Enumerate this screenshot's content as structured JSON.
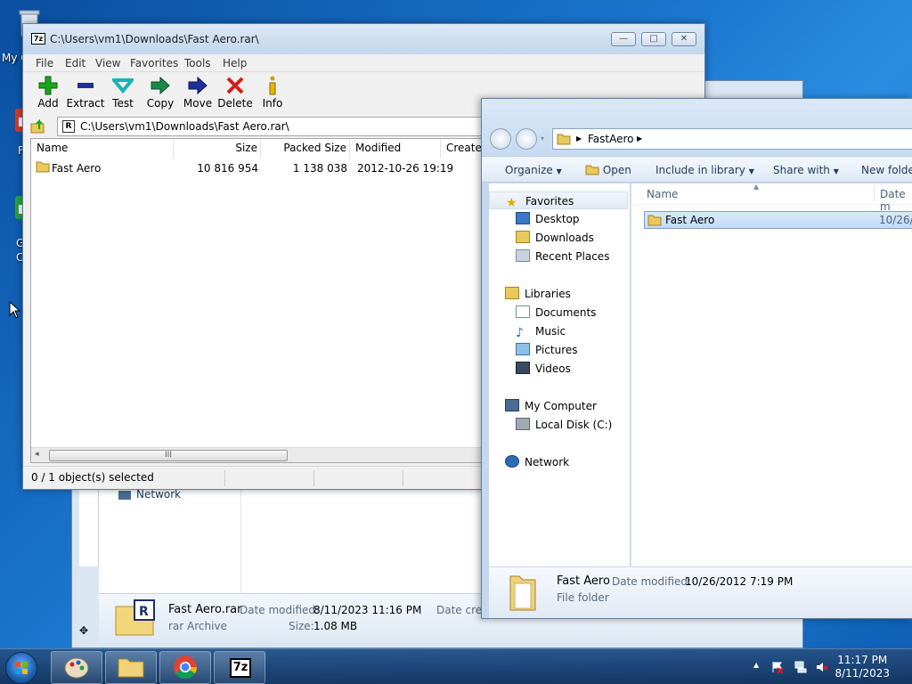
{
  "desktop": {
    "icon_labels": [
      "My C",
      "F",
      "G",
      "C"
    ]
  },
  "sevenzip": {
    "title": "C:\\Users\\vm1\\Downloads\\Fast Aero.rar\\",
    "title_icon": "7z",
    "menu": [
      "File",
      "Edit",
      "View",
      "Favorites",
      "Tools",
      "Help"
    ],
    "toolbar": [
      "Add",
      "Extract",
      "Test",
      "Copy",
      "Move",
      "Delete",
      "Info"
    ],
    "address": "C:\\Users\\vm1\\Downloads\\Fast Aero.rar\\",
    "columns": [
      "Name",
      "Size",
      "Packed Size",
      "Modified",
      "Created"
    ],
    "rows": [
      {
        "name": "Fast Aero",
        "size": "10 816 954",
        "packed": "1 138 038",
        "modified": "2012-10-26 19:19"
      }
    ],
    "scroll_thumb": "III",
    "status": "0 / 1 object(s) selected",
    "window_buttons": {
      "min": "—",
      "max": "□",
      "close": "✕"
    }
  },
  "bg_explorer": {
    "nav_item": "Network",
    "details": {
      "name": "Fast Aero.rar",
      "modified_label": "Date modified:",
      "modified": "8/11/2023 11:16 PM",
      "created_label": "Date creat",
      "type": "rar Archive",
      "size_label": "Size:",
      "size": "1.08 MB"
    }
  },
  "explorer": {
    "breadcrumb": [
      "FastAero"
    ],
    "commands": {
      "organize": "Organize",
      "open": "Open",
      "include": "Include in library",
      "share": "Share with",
      "new_folder": "New folder"
    },
    "nav": {
      "favorites": "Favorites",
      "desktop": "Desktop",
      "downloads": "Downloads",
      "recent": "Recent Places",
      "libraries": "Libraries",
      "documents": "Documents",
      "music": "Music",
      "pictures": "Pictures",
      "videos": "Videos",
      "computer": "My Computer",
      "localdisk": "Local Disk (C:)",
      "network": "Network"
    },
    "columns": {
      "name": "Name",
      "date": "Date m"
    },
    "row": {
      "name": "Fast Aero",
      "date": "10/26/"
    },
    "details": {
      "name": "Fast Aero",
      "modified_label": "Date modified:",
      "modified": "10/26/2012 7:19 PM",
      "type": "File folder"
    }
  },
  "taskbar": {
    "time": "11:17 PM",
    "date": "8/11/2023",
    "apps": [
      "paint",
      "explorer",
      "chrome",
      "7zip"
    ],
    "sevenzip_label": "7z"
  },
  "colors": {
    "add": "#1aa71a",
    "extract": "#1f2e9c",
    "test": "#18b3b3",
    "copy": "#1a8a4a",
    "move": "#1f2e9c",
    "delete": "#d21e1e",
    "info": "#c9a100"
  }
}
